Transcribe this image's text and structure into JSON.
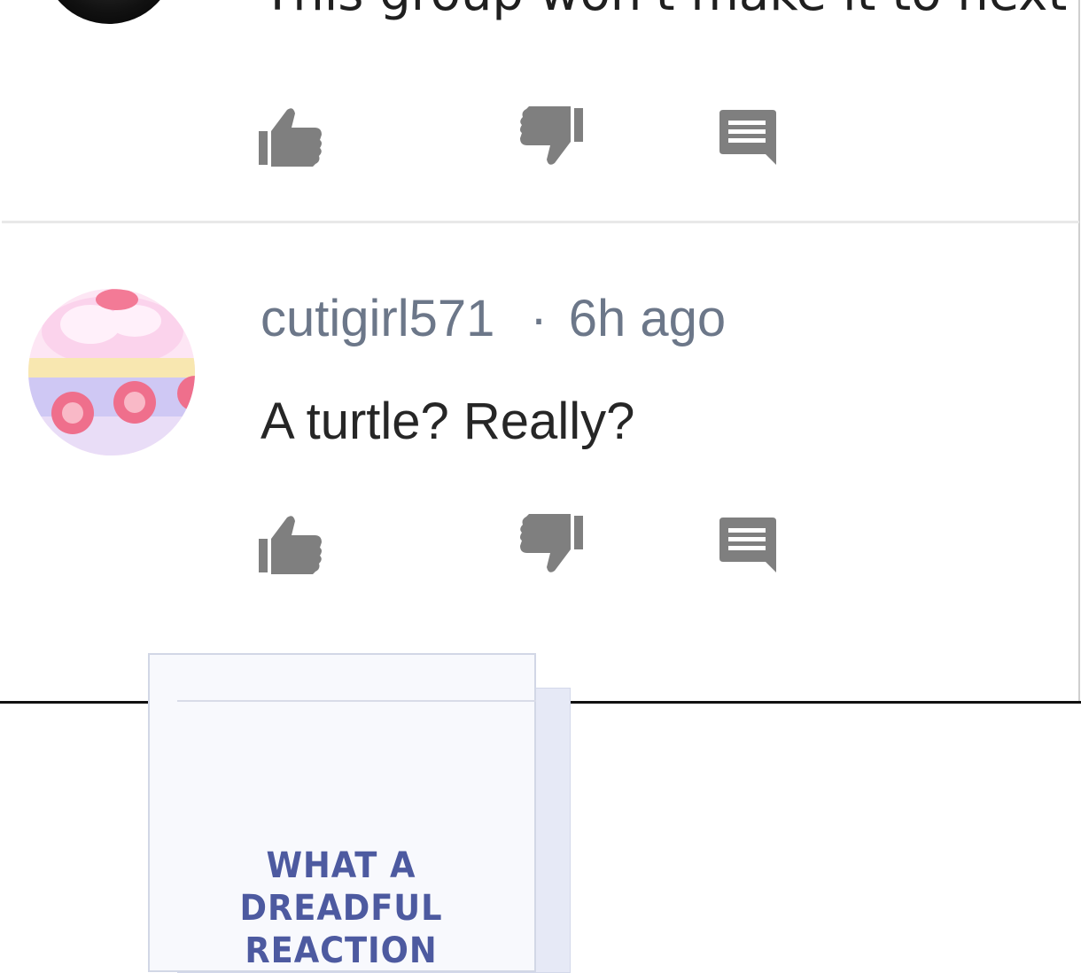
{
  "top_comment": {
    "body": "This group won't make it to next m",
    "actions": {
      "like_icon": "thumbs-up-icon",
      "dislike_icon": "thumbs-down-icon",
      "reply_icon": "comment-icon"
    }
  },
  "comment": {
    "username": "cutigirl571",
    "separator": "·",
    "time": "6h ago",
    "body": "A turtle? Really?",
    "avatar": "strawberry-cake-avatar",
    "actions": {
      "like_icon": "thumbs-up-icon",
      "dislike_icon": "thumbs-down-icon",
      "reply_icon": "comment-icon"
    }
  },
  "comic_panel": {
    "lines": [
      "WHAT A",
      "DREADFUL",
      "REACTION"
    ]
  },
  "colors": {
    "icon": "#7f7f7f",
    "meta": "#6c7789",
    "body": "#262626",
    "comic_text": "#4d5aa0"
  }
}
